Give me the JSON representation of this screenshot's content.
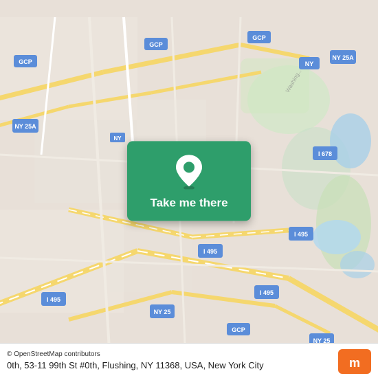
{
  "map": {
    "attribution": "© OpenStreetMap contributors",
    "address": "0th, 53-11 99th St #0th, Flushing, NY 11368, USA,\nNew York City"
  },
  "card": {
    "take_me_there_label": "Take me there"
  },
  "logos": {
    "moovit": "moovit"
  },
  "colors": {
    "card_bg": "#2e9e6b",
    "map_bg": "#e8e0d8",
    "road_yellow": "#f5d76e",
    "road_white": "#ffffff",
    "road_light": "#f0ebe3",
    "highway_blue": "#5b8dd9",
    "green_area": "#c8dfc8",
    "water_blue": "#a8d0e8"
  }
}
